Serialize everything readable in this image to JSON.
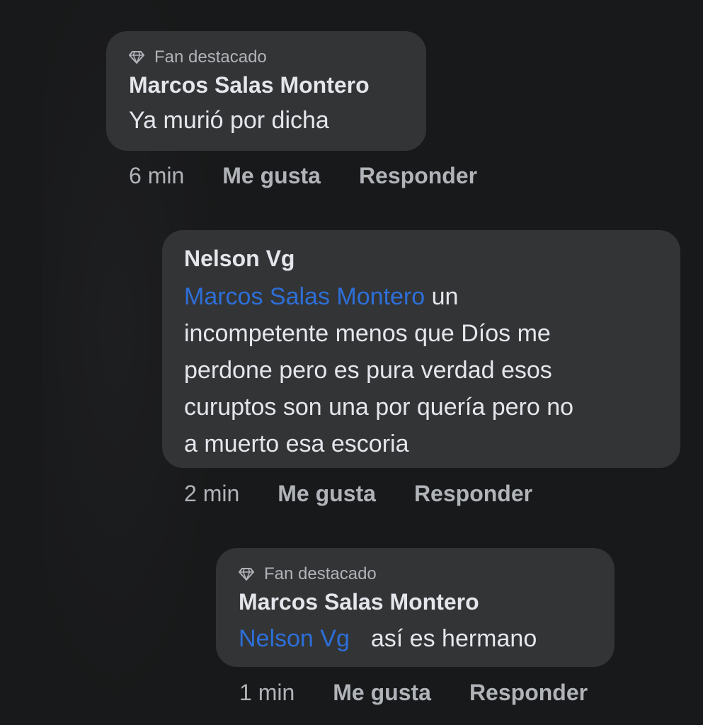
{
  "comments": [
    {
      "badge": "Fan destacado",
      "author": "Marcos Salas Montero",
      "text": "Ya murió por dicha",
      "time": "6 min",
      "like_label": "Me gusta",
      "reply_label": "Responder"
    },
    {
      "author": "Nelson Vg",
      "mention": "Marcos Salas Montero",
      "text_line1": " un",
      "text_line2": "incompetente menos que Díos me",
      "text_line3": "perdone pero es pura verdad esos",
      "text_line4": "curuptos son una por quería pero no",
      "text_line5": "a muerto esa escoria",
      "time": "2 min",
      "like_label": "Me gusta",
      "reply_label": "Responder"
    },
    {
      "badge": "Fan destacado",
      "author": "Marcos Salas Montero",
      "mention": "Nelson Vg",
      "text": "así es hermano",
      "time": "1 min",
      "like_label": "Me gusta",
      "reply_label": "Responder"
    }
  ],
  "colors": {
    "background": "#18191a",
    "bubble": "#333436",
    "mention": "#2d6fd8",
    "secondary_text": "#b0b3b8"
  },
  "icons": {
    "badge": "diamond-icon"
  }
}
